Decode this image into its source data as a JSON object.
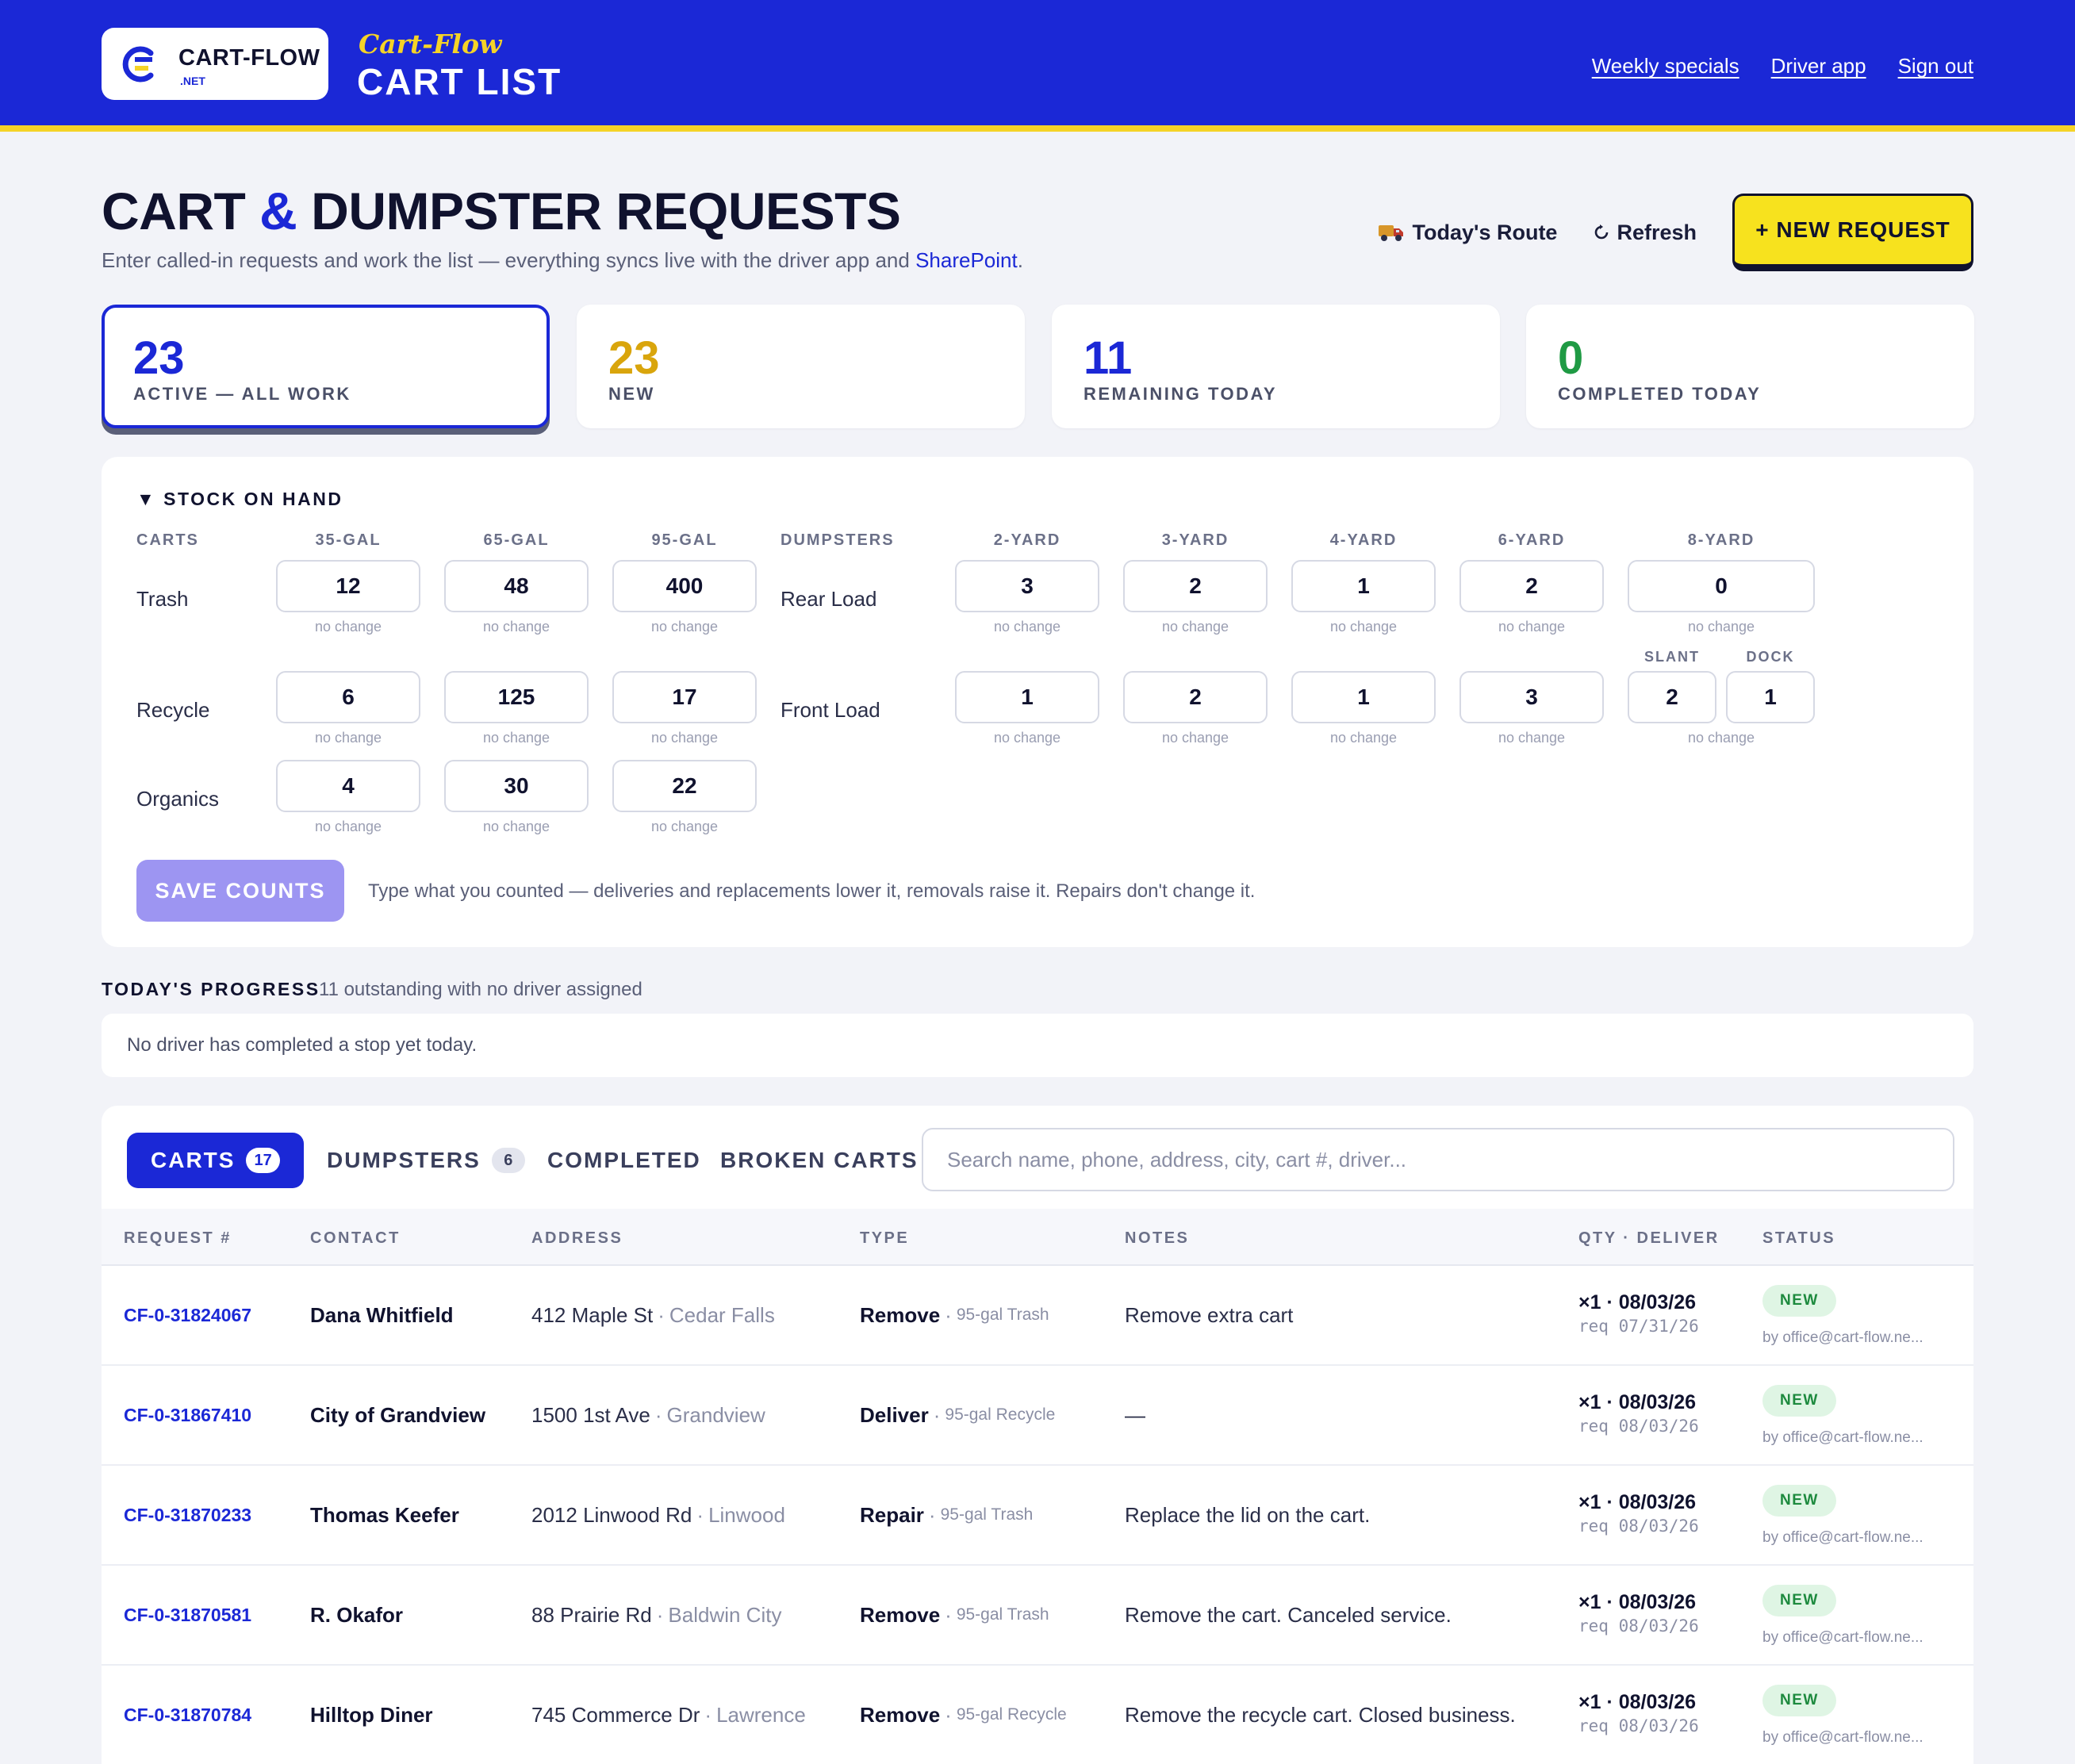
{
  "header": {
    "logo_name": "CART-FLOW",
    "logo_tld": ".NET",
    "brand_script": "Cart-Flow",
    "brand_title": "CART LIST",
    "nav": [
      "Weekly specials",
      "Driver app",
      "Sign out"
    ],
    "colors": {
      "primary": "#1b28d6",
      "accent": "#f5d327"
    }
  },
  "page": {
    "title_part1": "CART",
    "title_amp": "&",
    "title_part2": "DUMPSTER REQUESTS",
    "subtitle_pre": "Enter called-in requests and work the list — everything syncs live with the driver app and",
    "subtitle_link": "SharePoint",
    "subtitle_post": ".",
    "actions": {
      "route_icon": "truck-icon",
      "route_label": "Today's Route",
      "refresh_icon": "refresh-icon",
      "refresh_label": "Refresh",
      "new_label": "+ NEW REQUEST"
    }
  },
  "stats": [
    {
      "value": "23",
      "label": "ACTIVE — ALL WORK",
      "color": "#1b28d6"
    },
    {
      "value": "23",
      "label": "NEW",
      "color": "#d9a50c"
    },
    {
      "value": "11",
      "label": "REMAINING TODAY",
      "color": "#1b28d6"
    },
    {
      "value": "0",
      "label": "COMPLETED TODAY",
      "color": "#1f9a44"
    }
  ],
  "stock": {
    "title": "▼ STOCK ON HAND",
    "carts_label": "CARTS",
    "cart_sizes": [
      "35-GAL",
      "65-GAL",
      "95-GAL"
    ],
    "dumpsters_label": "DUMPSTERS",
    "dumpster_sizes": [
      "2-YARD",
      "3-YARD",
      "4-YARD",
      "6-YARD",
      "8-YARD"
    ],
    "slant_label": "SLANT",
    "dock_label": "DOCK",
    "no_change": "no change",
    "cart_rows": [
      {
        "label": "Trash",
        "counts": [
          "12",
          "48",
          "400"
        ]
      },
      {
        "label": "Recycle",
        "counts": [
          "6",
          "125",
          "17"
        ]
      },
      {
        "label": "Organics",
        "counts": [
          "4",
          "30",
          "22"
        ]
      }
    ],
    "dumpster_rows": [
      {
        "label": "Rear Load",
        "counts": [
          "3",
          "2",
          "1",
          "2",
          "0"
        ]
      },
      {
        "label": "Front Load",
        "counts": [
          "1",
          "2",
          "1",
          "3"
        ],
        "slant": "2",
        "dock": "1"
      }
    ],
    "save_label": "SAVE COUNTS",
    "save_hint": "Type what you counted — deliveries and replacements lower it, removals raise it. Repairs don't change it."
  },
  "progress": {
    "title": "TODAY'S PROGRESS",
    "note": "11 outstanding with no driver assigned",
    "message": "No driver has completed a stop yet today."
  },
  "list": {
    "tabs": [
      {
        "label": "CARTS",
        "count": "17"
      },
      {
        "label": "DUMPSTERS",
        "count": "6"
      },
      {
        "label": "COMPLETED"
      },
      {
        "label": "BROKEN CARTS"
      }
    ],
    "search_placeholder": "Search name, phone, address, city, cart #, driver...",
    "columns": [
      "REQUEST #",
      "CONTACT",
      "ADDRESS",
      "TYPE",
      "NOTES",
      "QTY · DELIVER",
      "STATUS"
    ],
    "rows": [
      {
        "id": "CF-0-31824067",
        "contact": "Dana Whitfield",
        "street": "412 Maple St",
        "city": "Cedar Falls",
        "type": "Remove",
        "cart": "95-gal Trash",
        "notes": "Remove extra cart",
        "qty": "×1 · 08/03/26",
        "req": "req 07/31/26",
        "status": "NEW",
        "by": "by office@cart-flow.ne..."
      },
      {
        "id": "CF-0-31867410",
        "contact": "City of Grandview",
        "street": "1500 1st Ave",
        "city": "Grandview",
        "type": "Deliver",
        "cart": "95-gal Recycle",
        "notes": "—",
        "qty": "×1 · 08/03/26",
        "req": "req 08/03/26",
        "status": "NEW",
        "by": "by office@cart-flow.ne..."
      },
      {
        "id": "CF-0-31870233",
        "contact": "Thomas Keefer",
        "street": "2012 Linwood Rd",
        "city": "Linwood",
        "type": "Repair",
        "cart": "95-gal Trash",
        "notes": "Replace the lid on the cart.",
        "qty": "×1 · 08/03/26",
        "req": "req 08/03/26",
        "status": "NEW",
        "by": "by office@cart-flow.ne..."
      },
      {
        "id": "CF-0-31870581",
        "contact": "R. Okafor",
        "street": "88 Prairie Rd",
        "city": "Baldwin City",
        "type": "Remove",
        "cart": "95-gal Trash",
        "notes": "Remove the cart. Canceled service.",
        "qty": "×1 · 08/03/26",
        "req": "req 08/03/26",
        "status": "NEW",
        "by": "by office@cart-flow.ne..."
      },
      {
        "id": "CF-0-31870784",
        "contact": "Hilltop Diner",
        "street": "745 Commerce Dr",
        "city": "Lawrence",
        "type": "Remove",
        "cart": "95-gal Recycle",
        "notes": "Remove the recycle cart. Closed business.",
        "qty": "×1 · 08/03/26",
        "req": "req 08/03/26",
        "status": "NEW",
        "by": "by office@cart-flow.ne..."
      }
    ]
  }
}
